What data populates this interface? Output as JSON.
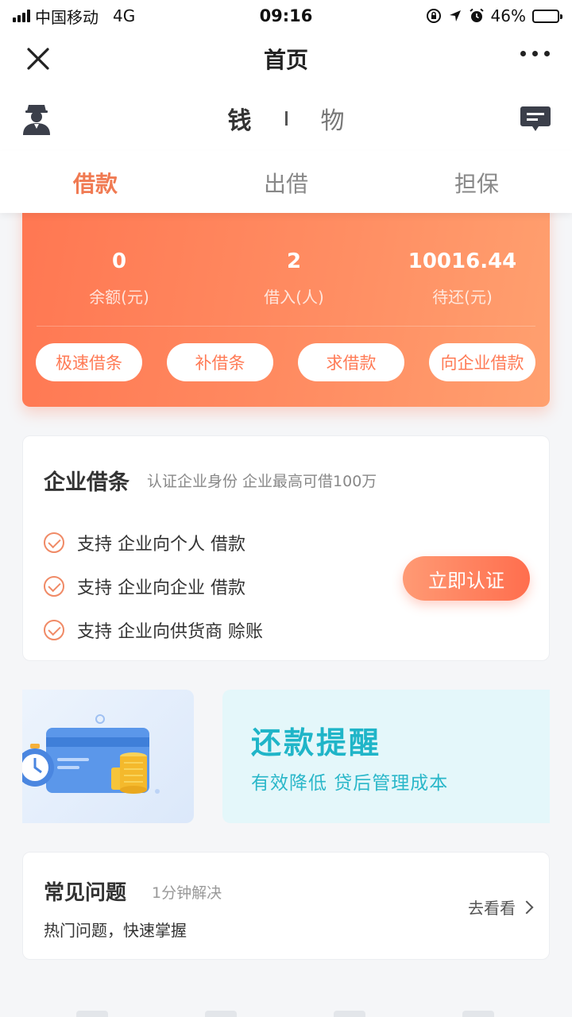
{
  "status_bar": {
    "carrier": "中国移动",
    "network": "4G",
    "time": "09:16",
    "battery": "46%",
    "battery_level": 0.46
  },
  "nav": {
    "title": "首页",
    "close_icon": "close-icon",
    "more_icon": "more-icon"
  },
  "switcher": {
    "money": "钱",
    "goods": "物",
    "user_icon": "user-icon",
    "message_icon": "message-icon"
  },
  "tabs": [
    {
      "label": "借款",
      "active": true
    },
    {
      "label": "出借",
      "active": false
    },
    {
      "label": "担保",
      "active": false
    }
  ],
  "summary": {
    "stats": [
      {
        "value": "0",
        "label": "余额(元)"
      },
      {
        "value": "2",
        "label": "借入(人)"
      },
      {
        "value": "10016.44",
        "label": "待还(元)"
      }
    ],
    "buttons": [
      "极速借条",
      "补借条",
      "求借款",
      "向企业借款"
    ]
  },
  "enterprise": {
    "title": "企业借条",
    "subtitle": "认证企业身份 企业最高可借100万",
    "features": [
      "支持 企业向个人 借款",
      "支持 企业向企业 借款",
      "支持 企业向供货商 赊账"
    ],
    "cta": "立即认证"
  },
  "banner": {
    "title": "还款提醒",
    "subtitle": "有效降低 贷后管理成本"
  },
  "faq": {
    "title": "常见问题",
    "tag": "1分钟解决",
    "subtitle": "热门问题，快速掌握",
    "link": "去看看"
  },
  "colors": {
    "accent": "#f07a52",
    "orange_card": "#ff7752",
    "teal": "#1fb5c8"
  }
}
